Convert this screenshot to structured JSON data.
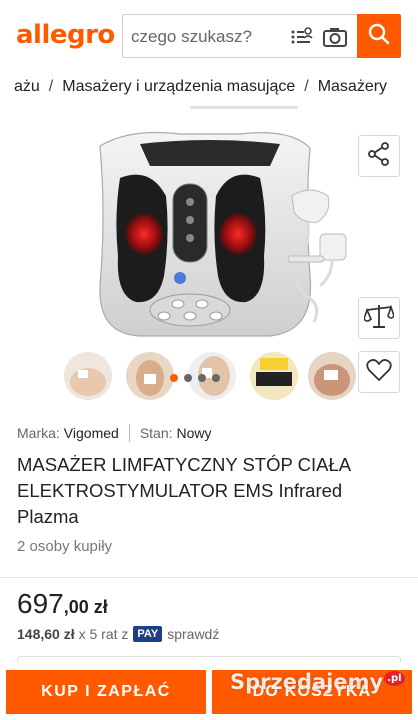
{
  "header": {
    "logo": "allegro",
    "search_placeholder": "czego szukasz?"
  },
  "breadcrumb": [
    "ażu",
    "Masażery i urządzenia masujące",
    "Masażery"
  ],
  "gallery": {
    "main_image": "foot-massager-photo",
    "thumbnail_count": 5,
    "active_dot": 0,
    "dot_count": 4
  },
  "actions": {
    "share_icon": "share-icon",
    "compare_icon": "scales-icon",
    "favorite_icon": "heart-icon"
  },
  "product": {
    "brand_label": "Marka:",
    "brand_value": "Vigomed",
    "condition_label": "Stan:",
    "condition_value": "Nowy",
    "title": "MASAŻER LIMFATYCZNY STÓP CIAŁA ELEKTROSTYMULATOR EMS Infrared Plazma",
    "sold": "2 osoby kupiły"
  },
  "price": {
    "main": "697",
    "cents": ",00 zł",
    "installment_amount": "148,60 zł",
    "installment_text": "x 5 rat z",
    "pay_badge": "PAY",
    "check_text": "sprawdź"
  },
  "bottom": {
    "buy_label": "KUP I ZAPŁAĆ",
    "cart_label": "DO KOSZYKA",
    "watermark": "Sprzedajemy",
    "watermark_suffix": ".pl"
  },
  "colors": {
    "brand": "#ff5a00",
    "pay_badge": "#1c3f8a"
  }
}
